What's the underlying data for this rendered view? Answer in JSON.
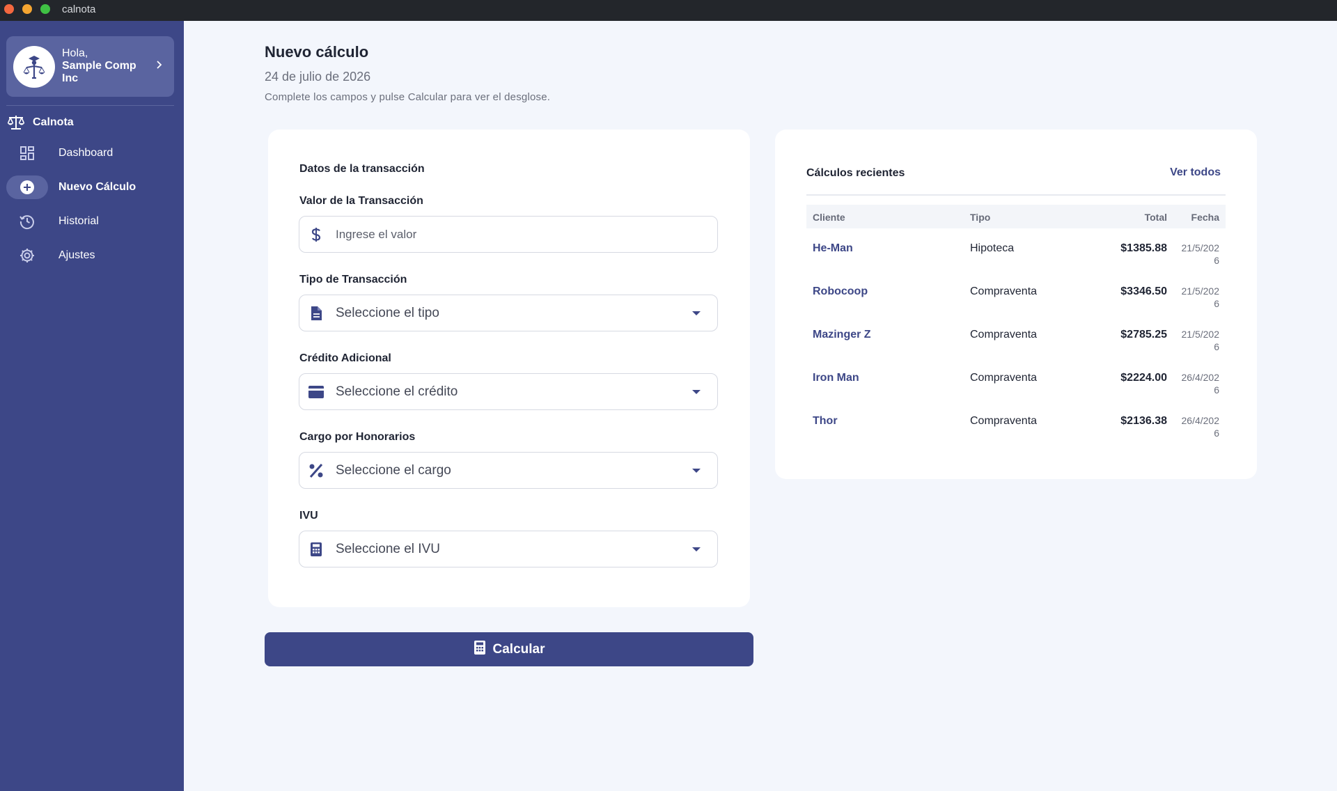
{
  "window": {
    "title": "calnota"
  },
  "sidebar": {
    "greeting": "Hola,",
    "user_name": "Sample Comp Inc",
    "brand": "Calnota",
    "items": [
      {
        "label": "Dashboard",
        "icon": "dashboard-icon",
        "active": false
      },
      {
        "label": "Nuevo Cálculo",
        "icon": "add-circle-icon",
        "active": true
      },
      {
        "label": "Historial",
        "icon": "history-icon",
        "active": false
      },
      {
        "label": "Ajustes",
        "icon": "gear-icon",
        "active": false
      }
    ]
  },
  "header": {
    "title": "Nuevo cálculo",
    "date": "24 de julio de 2026",
    "hint": "Complete los campos y pulse Calcular para ver el desglose."
  },
  "form": {
    "section_title": "Datos de la transacción",
    "value_label": "Valor de la Transacción",
    "value_placeholder": "Ingrese el valor",
    "type_label": "Tipo de Transacción",
    "type_value": "Seleccione el tipo",
    "credit_label": "Crédito Adicional",
    "credit_value": "Seleccione el crédito",
    "fee_label": "Cargo por Honorarios",
    "fee_value": "Seleccione el cargo",
    "ivu_label": "IVU",
    "ivu_value": "Seleccione el IVU",
    "calculate_label": "Calcular"
  },
  "recent": {
    "title": "Cálculos recientes",
    "see_all": "Ver todos",
    "columns": {
      "client": "Cliente",
      "type": "Tipo",
      "total": "Total",
      "date": "Fecha"
    },
    "rows": [
      {
        "client": "He-Man",
        "type": "Hipoteca",
        "total": "$1385.88",
        "date": "21/5/2026"
      },
      {
        "client": "Robocoop",
        "type": "Compraventa",
        "total": "$3346.50",
        "date": "21/5/2026"
      },
      {
        "client": "Mazinger Z",
        "type": "Compraventa",
        "total": "$2785.25",
        "date": "21/5/2026"
      },
      {
        "client": "Iron Man",
        "type": "Compraventa",
        "total": "$2224.00",
        "date": "26/4/2026"
      },
      {
        "client": "Thor",
        "type": "Compraventa",
        "total": "$2136.38",
        "date": "26/4/2026"
      }
    ]
  },
  "colors": {
    "sidebar": "#3d4787",
    "sidebar_highlight": "#5a64a0",
    "accent": "#3d4787",
    "background": "#f3f6fc",
    "card": "#ffffff"
  }
}
